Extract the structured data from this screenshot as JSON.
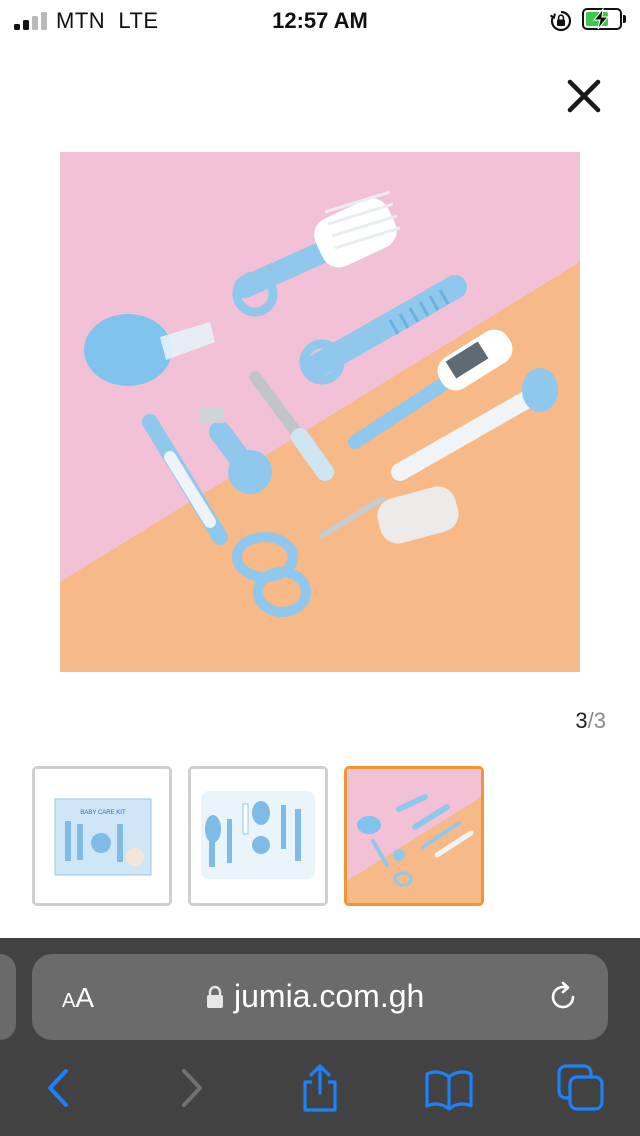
{
  "status_bar": {
    "carrier": "MTN",
    "network": "LTE",
    "time": "12:57 AM",
    "signal_bars_active": 2,
    "signal_bars_total": 4,
    "battery_charging": true,
    "icons": [
      "signal-icon",
      "orientation-lock-icon",
      "battery-charging-icon"
    ]
  },
  "gallery": {
    "close_icon": "close-icon",
    "current": "3",
    "separator_total": "/3",
    "thumbnails": [
      {
        "name": "thumbnail-1",
        "selected": false
      },
      {
        "name": "thumbnail-2",
        "selected": false
      },
      {
        "name": "thumbnail-3",
        "selected": true
      }
    ],
    "box_label": "BABY CARE KIT"
  },
  "browser": {
    "text_size_small": "A",
    "text_size_large": "A",
    "domain": "jumia.com.gh",
    "secure": true,
    "toolbar": [
      "back-icon",
      "forward-icon",
      "share-icon",
      "bookmarks-icon",
      "tabs-icon"
    ]
  },
  "colors": {
    "accent_selected": "#f39533",
    "thumb_border": "#cfcfcf",
    "browser_chrome": "#424242",
    "url_field": "#6b6b6b",
    "ios_blue": "#1a82fb",
    "battery_green": "#3ec94b",
    "product_blue": "#8fc8ec",
    "bg_pink": "#f2c1d6",
    "bg_peach": "#f6b987"
  }
}
